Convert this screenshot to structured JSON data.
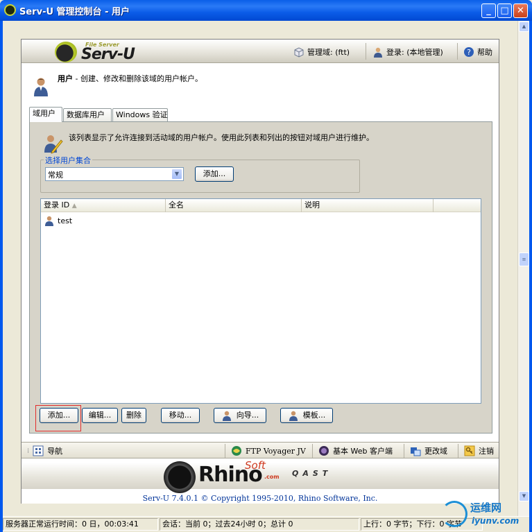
{
  "window": {
    "title": "Serv-U 管理控制台 - 用户",
    "min": "_",
    "max": "□",
    "close": "✕"
  },
  "toolbar": {
    "logo_small": "File Server",
    "logo_text": "Serv-U",
    "domain_label": "管理域: (ftt)",
    "login_label": "登录: (本地管理)",
    "help_label": "帮助"
  },
  "header": {
    "title": "用户",
    "description": "- 创建、修改和删除该域的用户帐户。"
  },
  "tabs": [
    {
      "label": "域用户",
      "active": true
    },
    {
      "label": "数据库用户",
      "active": false
    },
    {
      "label": "Windows 验证",
      "active": false
    }
  ],
  "pane": {
    "info": "该列表显示了允许连接到活动域的用户帐户。使用此列表和列出的按钮对域用户进行维护。",
    "group_label": "选择用户集合",
    "collection_value": "常规",
    "add_collection_button": "添加...",
    "columns": [
      "登录 ID",
      "全名",
      "说明"
    ],
    "rows": [
      {
        "login": "test",
        "fullname": "",
        "description": ""
      }
    ],
    "actions": {
      "add": "添加...",
      "edit": "编辑...",
      "delete": "删除",
      "move": "移动...",
      "wizard": "向导...",
      "template": "模板..."
    }
  },
  "nav": {
    "navigation": "导航",
    "ftp_voyager": "FTP Voyager JV",
    "web_client": "基本 Web 客户端",
    "change_domain": "更改域",
    "logout": "注销"
  },
  "footer": {
    "soft": "Soft",
    "rhino": "Rhino",
    "com": ".com",
    "qast": "QAST",
    "copyright": "Serv-U 7.4.0.1 © Copyright 1995-2010, Rhino Software, Inc."
  },
  "status": {
    "uptime": "服务器正常运行时间：0 日，00:03:41",
    "sessions": "会话：当前 0；过去24小时 0；总计 0",
    "traffic": "上行：0 字节；下行：0 字节"
  },
  "watermark": {
    "cn": "运维网",
    "url": "iyunv.com"
  },
  "colors": {
    "title_blue": "#0a5fe8",
    "group_label_blue": "#0046d5",
    "selection_red": "#e22c2c"
  }
}
